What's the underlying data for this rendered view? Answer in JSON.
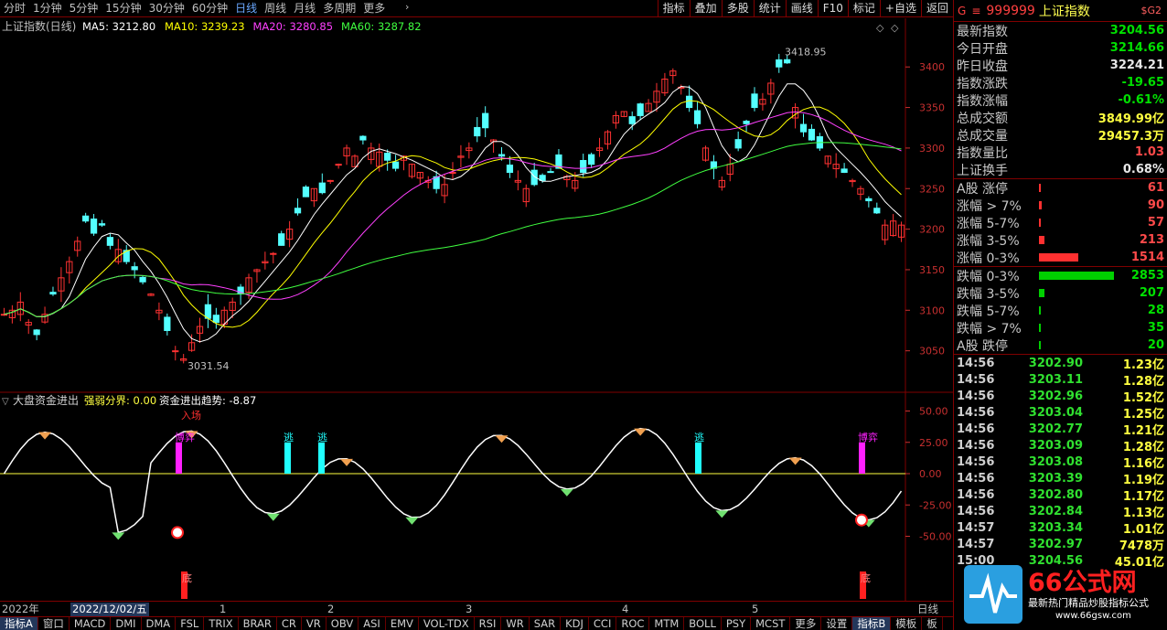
{
  "periods": [
    {
      "label": "分时",
      "active": false
    },
    {
      "label": "1分钟",
      "active": false
    },
    {
      "label": "5分钟",
      "active": false
    },
    {
      "label": "15分钟",
      "active": false
    },
    {
      "label": "30分钟",
      "active": false
    },
    {
      "label": "60分钟",
      "active": false
    },
    {
      "label": "日线",
      "active": true
    },
    {
      "label": "周线",
      "active": false
    },
    {
      "label": "月线",
      "active": false
    },
    {
      "label": "多周期",
      "active": false
    },
    {
      "label": "更多",
      "active": false
    }
  ],
  "toolbar": [
    "指标",
    "叠加",
    "多股",
    "统计",
    "画线",
    "F10",
    "标记",
    "+自选",
    "返回"
  ],
  "chart_title": "上证指数(日线)",
  "ma": [
    {
      "label": "MA5: 3212.80",
      "color": "#ffffff"
    },
    {
      "label": "MA10: 3239.23",
      "color": "#ffff00"
    },
    {
      "label": "MA20: 3280.85",
      "color": "#ff40ff"
    },
    {
      "label": "MA60: 3287.82",
      "color": "#40ff40"
    }
  ],
  "price_axis": [
    "3400",
    "3350",
    "3300",
    "3250",
    "3200",
    "3150",
    "3100",
    "3050"
  ],
  "price_annotations": {
    "high": "3418.95",
    "low": "3031.54"
  },
  "indicator": {
    "name": "大盘资金进出",
    "params": [
      {
        "label": "强弱分界: 0.00",
        "color": "#ffff40"
      },
      {
        "label": "资金进出趋势: -8.87",
        "color": "#ffffff"
      }
    ],
    "axis": [
      "50.00",
      "25.00",
      "0.00",
      "-25.00",
      "-50.00"
    ],
    "signals": {
      "buy": "入场",
      "game": "博弈",
      "escape": "逃",
      "bottom": "底"
    }
  },
  "time_axis": {
    "year": "2022年",
    "cursor_date": "2022/12/02/五",
    "months": [
      "1",
      "2",
      "3",
      "4",
      "5"
    ],
    "period": "日线"
  },
  "bottom_tabs": [
    "指标A",
    "窗口",
    "MACD",
    "DMI",
    "DMA",
    "FSL",
    "TRIX",
    "BRAR",
    "CR",
    "VR",
    "OBV",
    "ASI",
    "EMV",
    "VOL-TDX",
    "RSI",
    "WR",
    "SAR",
    "KDJ",
    "CCI",
    "ROC",
    "MTM",
    "BOLL",
    "PSY",
    "MCST",
    "更多",
    "设置",
    "指标B",
    "模板",
    "板"
  ],
  "quote": {
    "g": "G",
    "code": "999999",
    "name": "上证指数",
    "sub": "$G2",
    "rows": [
      {
        "k": "最新指数",
        "v": "3204.56",
        "c": "green"
      },
      {
        "k": "今日开盘",
        "v": "3214.66",
        "c": "green"
      },
      {
        "k": "昨日收盘",
        "v": "3224.21",
        "c": "white"
      },
      {
        "k": "指数涨跌",
        "v": "-19.65",
        "c": "green"
      },
      {
        "k": "指数涨幅",
        "v": "-0.61%",
        "c": "green"
      },
      {
        "k": "总成交额",
        "v": "3849.99亿",
        "c": "yellow"
      },
      {
        "k": "总成交量",
        "v": "29457.3万",
        "c": "yellow"
      },
      {
        "k": "指数量比",
        "v": "1.03",
        "c": "red"
      },
      {
        "k": "上证换手",
        "v": "0.68%",
        "c": "white"
      }
    ],
    "breadth_up": [
      {
        "k": "A股 涨停",
        "v": "61",
        "w": 2
      },
      {
        "k": "涨幅 > 7%",
        "v": "90",
        "w": 3
      },
      {
        "k": "涨幅 5-7%",
        "v": "57",
        "w": 2
      },
      {
        "k": "涨幅 3-5%",
        "v": "213",
        "w": 6
      },
      {
        "k": "涨幅 0-3%",
        "v": "1514",
        "w": 43
      }
    ],
    "breadth_down": [
      {
        "k": "跌幅 0-3%",
        "v": "2853",
        "w": 82
      },
      {
        "k": "跌幅 3-5%",
        "v": "207",
        "w": 6
      },
      {
        "k": "跌幅 5-7%",
        "v": "28",
        "w": 2
      },
      {
        "k": "跌幅 > 7%",
        "v": "35",
        "w": 2
      },
      {
        "k": "A股 跌停",
        "v": "20",
        "w": 2
      }
    ],
    "ticks": [
      {
        "t": "14:56",
        "p": "3202.90",
        "v": "1.23亿"
      },
      {
        "t": "14:56",
        "p": "3203.11",
        "v": "1.28亿"
      },
      {
        "t": "14:56",
        "p": "3202.96",
        "v": "1.52亿"
      },
      {
        "t": "14:56",
        "p": "3203.04",
        "v": "1.25亿"
      },
      {
        "t": "14:56",
        "p": "3202.77",
        "v": "1.21亿"
      },
      {
        "t": "14:56",
        "p": "3203.09",
        "v": "1.28亿"
      },
      {
        "t": "14:56",
        "p": "3203.08",
        "v": "1.16亿"
      },
      {
        "t": "14:56",
        "p": "3203.39",
        "v": "1.19亿"
      },
      {
        "t": "14:56",
        "p": "3202.80",
        "v": "1.17亿"
      },
      {
        "t": "14:56",
        "p": "3202.84",
        "v": "1.13亿"
      },
      {
        "t": "14:57",
        "p": "3203.34",
        "v": "1.01亿"
      },
      {
        "t": "14:57",
        "p": "3202.97",
        "v": "7478万"
      },
      {
        "t": "15:00",
        "p": "3204.56",
        "v": "45.01亿"
      }
    ]
  },
  "logo": {
    "brand": "66公式网",
    "tagline": "最新热门精品炒股指标公式",
    "url": "www.66gsw.com"
  },
  "colors": {
    "up": "#ff3232",
    "down": "#54ffff",
    "grid": "#800000",
    "axis": "#c83030"
  }
}
